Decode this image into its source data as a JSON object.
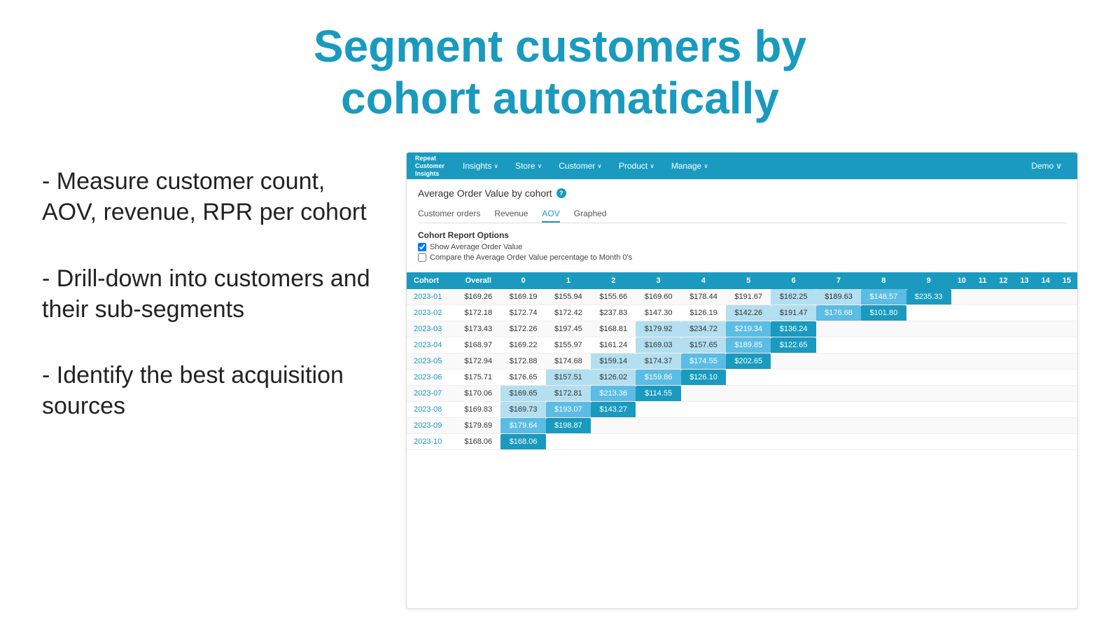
{
  "page": {
    "title_line1": "Segment customers by",
    "title_line2": "cohort automatically"
  },
  "bullets": [
    "- Measure customer count, AOV, revenue, RPR per cohort",
    "- Drill-down into customers and their sub-segments",
    "- Identify the best acquisition sources"
  ],
  "nav": {
    "logo": "Repeat\nCustomer\nInsights",
    "items": [
      {
        "label": "Insights",
        "chevron": "∨"
      },
      {
        "label": "Store",
        "chevron": "∨"
      },
      {
        "label": "Customer",
        "chevron": "∨"
      },
      {
        "label": "Product",
        "chevron": "∨"
      },
      {
        "label": "Manage",
        "chevron": "∨"
      }
    ],
    "demo": {
      "label": "Demo",
      "chevron": "∨"
    }
  },
  "report": {
    "title": "Average Order Value by cohort",
    "help": "?",
    "tabs": [
      {
        "label": "Customer orders",
        "active": false
      },
      {
        "label": "Revenue",
        "active": false
      },
      {
        "label": "AOV",
        "active": true
      },
      {
        "label": "Graphed",
        "active": false
      }
    ],
    "options_title": "Cohort Report Options",
    "checkbox1": {
      "label": "Show Average Order Value",
      "checked": true
    },
    "checkbox2": {
      "label": "Compare the Average Order Value percentage to Month 0's",
      "checked": false
    }
  },
  "table": {
    "headers": [
      "Cohort",
      "Overall",
      "0",
      "1",
      "2",
      "3",
      "4",
      "5",
      "6",
      "7",
      "8",
      "9",
      "10",
      "11",
      "12",
      "13",
      "14",
      "15"
    ],
    "rows": [
      {
        "cohort": "2023-01",
        "overall": "$169.26",
        "cells": [
          "$169.19",
          "$155.94",
          "$155.66",
          "$169.60",
          "$178.44",
          "$191.67",
          "$162.25",
          "$189.63",
          "$148.57",
          "$235.33",
          "",
          "",
          "",
          "",
          "",
          ""
        ]
      },
      {
        "cohort": "2023-02",
        "overall": "$172.18",
        "cells": [
          "$172.74",
          "$172.42",
          "$237.83",
          "$147.30",
          "$126.19",
          "$142.26",
          "$191.47",
          "$176.68",
          "$101.80",
          "",
          "",
          "",
          "",
          "",
          "",
          ""
        ]
      },
      {
        "cohort": "2023-03",
        "overall": "$173.43",
        "cells": [
          "$172.26",
          "$197.45",
          "$168.81",
          "$179.92",
          "$234.72",
          "$219.34",
          "$136.24",
          "",
          "",
          "",
          "",
          "",
          "",
          "",
          "",
          ""
        ]
      },
      {
        "cohort": "2023-04",
        "overall": "$168.97",
        "cells": [
          "$169.22",
          "$155.97",
          "$161.24",
          "$169.03",
          "$157.65",
          "$189.85",
          "$122.65",
          "",
          "",
          "",
          "",
          "",
          "",
          "",
          "",
          ""
        ]
      },
      {
        "cohort": "2023-05",
        "overall": "$172.94",
        "cells": [
          "$172.88",
          "$174.68",
          "$159.14",
          "$174.37",
          "$174.55",
          "$202.65",
          "",
          "",
          "",
          "",
          "",
          "",
          "",
          "",
          "",
          ""
        ]
      },
      {
        "cohort": "2023-06",
        "overall": "$175.71",
        "cells": [
          "$176.65",
          "$157.51",
          "$126.02",
          "$159.86",
          "$126.10",
          "",
          "",
          "",
          "",
          "",
          "",
          "",
          "",
          "",
          "",
          ""
        ]
      },
      {
        "cohort": "2023-07",
        "overall": "$170.06",
        "cells": [
          "$169.65",
          "$172.81",
          "$213.36",
          "$114.55",
          "",
          "",
          "",
          "",
          "",
          "",
          "",
          "",
          "",
          "",
          "",
          ""
        ]
      },
      {
        "cohort": "2023-08",
        "overall": "$169.83",
        "cells": [
          "$169.73",
          "$193.07",
          "$143.27",
          "",
          "",
          "",
          "",
          "",
          "",
          "",
          "",
          "",
          "",
          "",
          "",
          ""
        ]
      },
      {
        "cohort": "2023-09",
        "overall": "$179.69",
        "cells": [
          "$179.64",
          "$198.87",
          "",
          "",
          "",
          "",
          "",
          "",
          "",
          "",
          "",
          "",
          "",
          "",
          "",
          ""
        ]
      },
      {
        "cohort": "2023-10",
        "overall": "$168.06",
        "cells": [
          "$168.06",
          "",
          "",
          "",
          "",
          "",
          "",
          "",
          "",
          "",
          "",
          "",
          "",
          "",
          "",
          ""
        ]
      }
    ]
  }
}
